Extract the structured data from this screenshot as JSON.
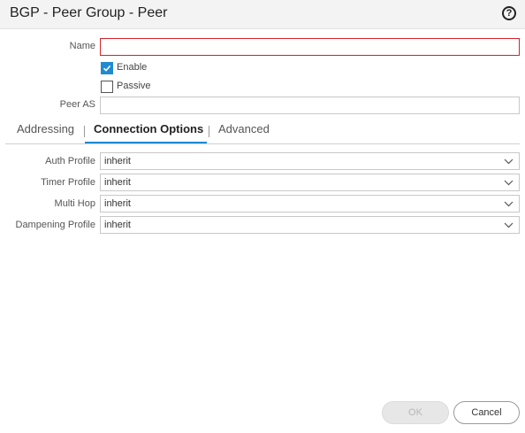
{
  "dialog": {
    "title": "BGP - Peer Group - Peer",
    "help_icon": "help-icon",
    "help_glyph": "?"
  },
  "form": {
    "name_label": "Name",
    "name_value": "",
    "enable_label": "Enable",
    "enable_checked": true,
    "passive_label": "Passive",
    "passive_checked": false,
    "peer_as_label": "Peer AS",
    "peer_as_value": ""
  },
  "tabs": [
    {
      "label": "Addressing",
      "active": false
    },
    {
      "label": "Connection Options",
      "active": true
    },
    {
      "label": "Advanced",
      "active": false
    }
  ],
  "connection_options": [
    {
      "label": "Auth Profile",
      "value": "inherit"
    },
    {
      "label": "Timer Profile",
      "value": "inherit"
    },
    {
      "label": "Multi Hop",
      "value": "inherit"
    },
    {
      "label": "Dampening Profile",
      "value": "inherit"
    }
  ],
  "buttons": {
    "ok_label": "OK",
    "ok_enabled": false,
    "cancel_label": "Cancel"
  },
  "colors": {
    "accent": "#1f8bd1",
    "error_border": "#d2232a"
  }
}
